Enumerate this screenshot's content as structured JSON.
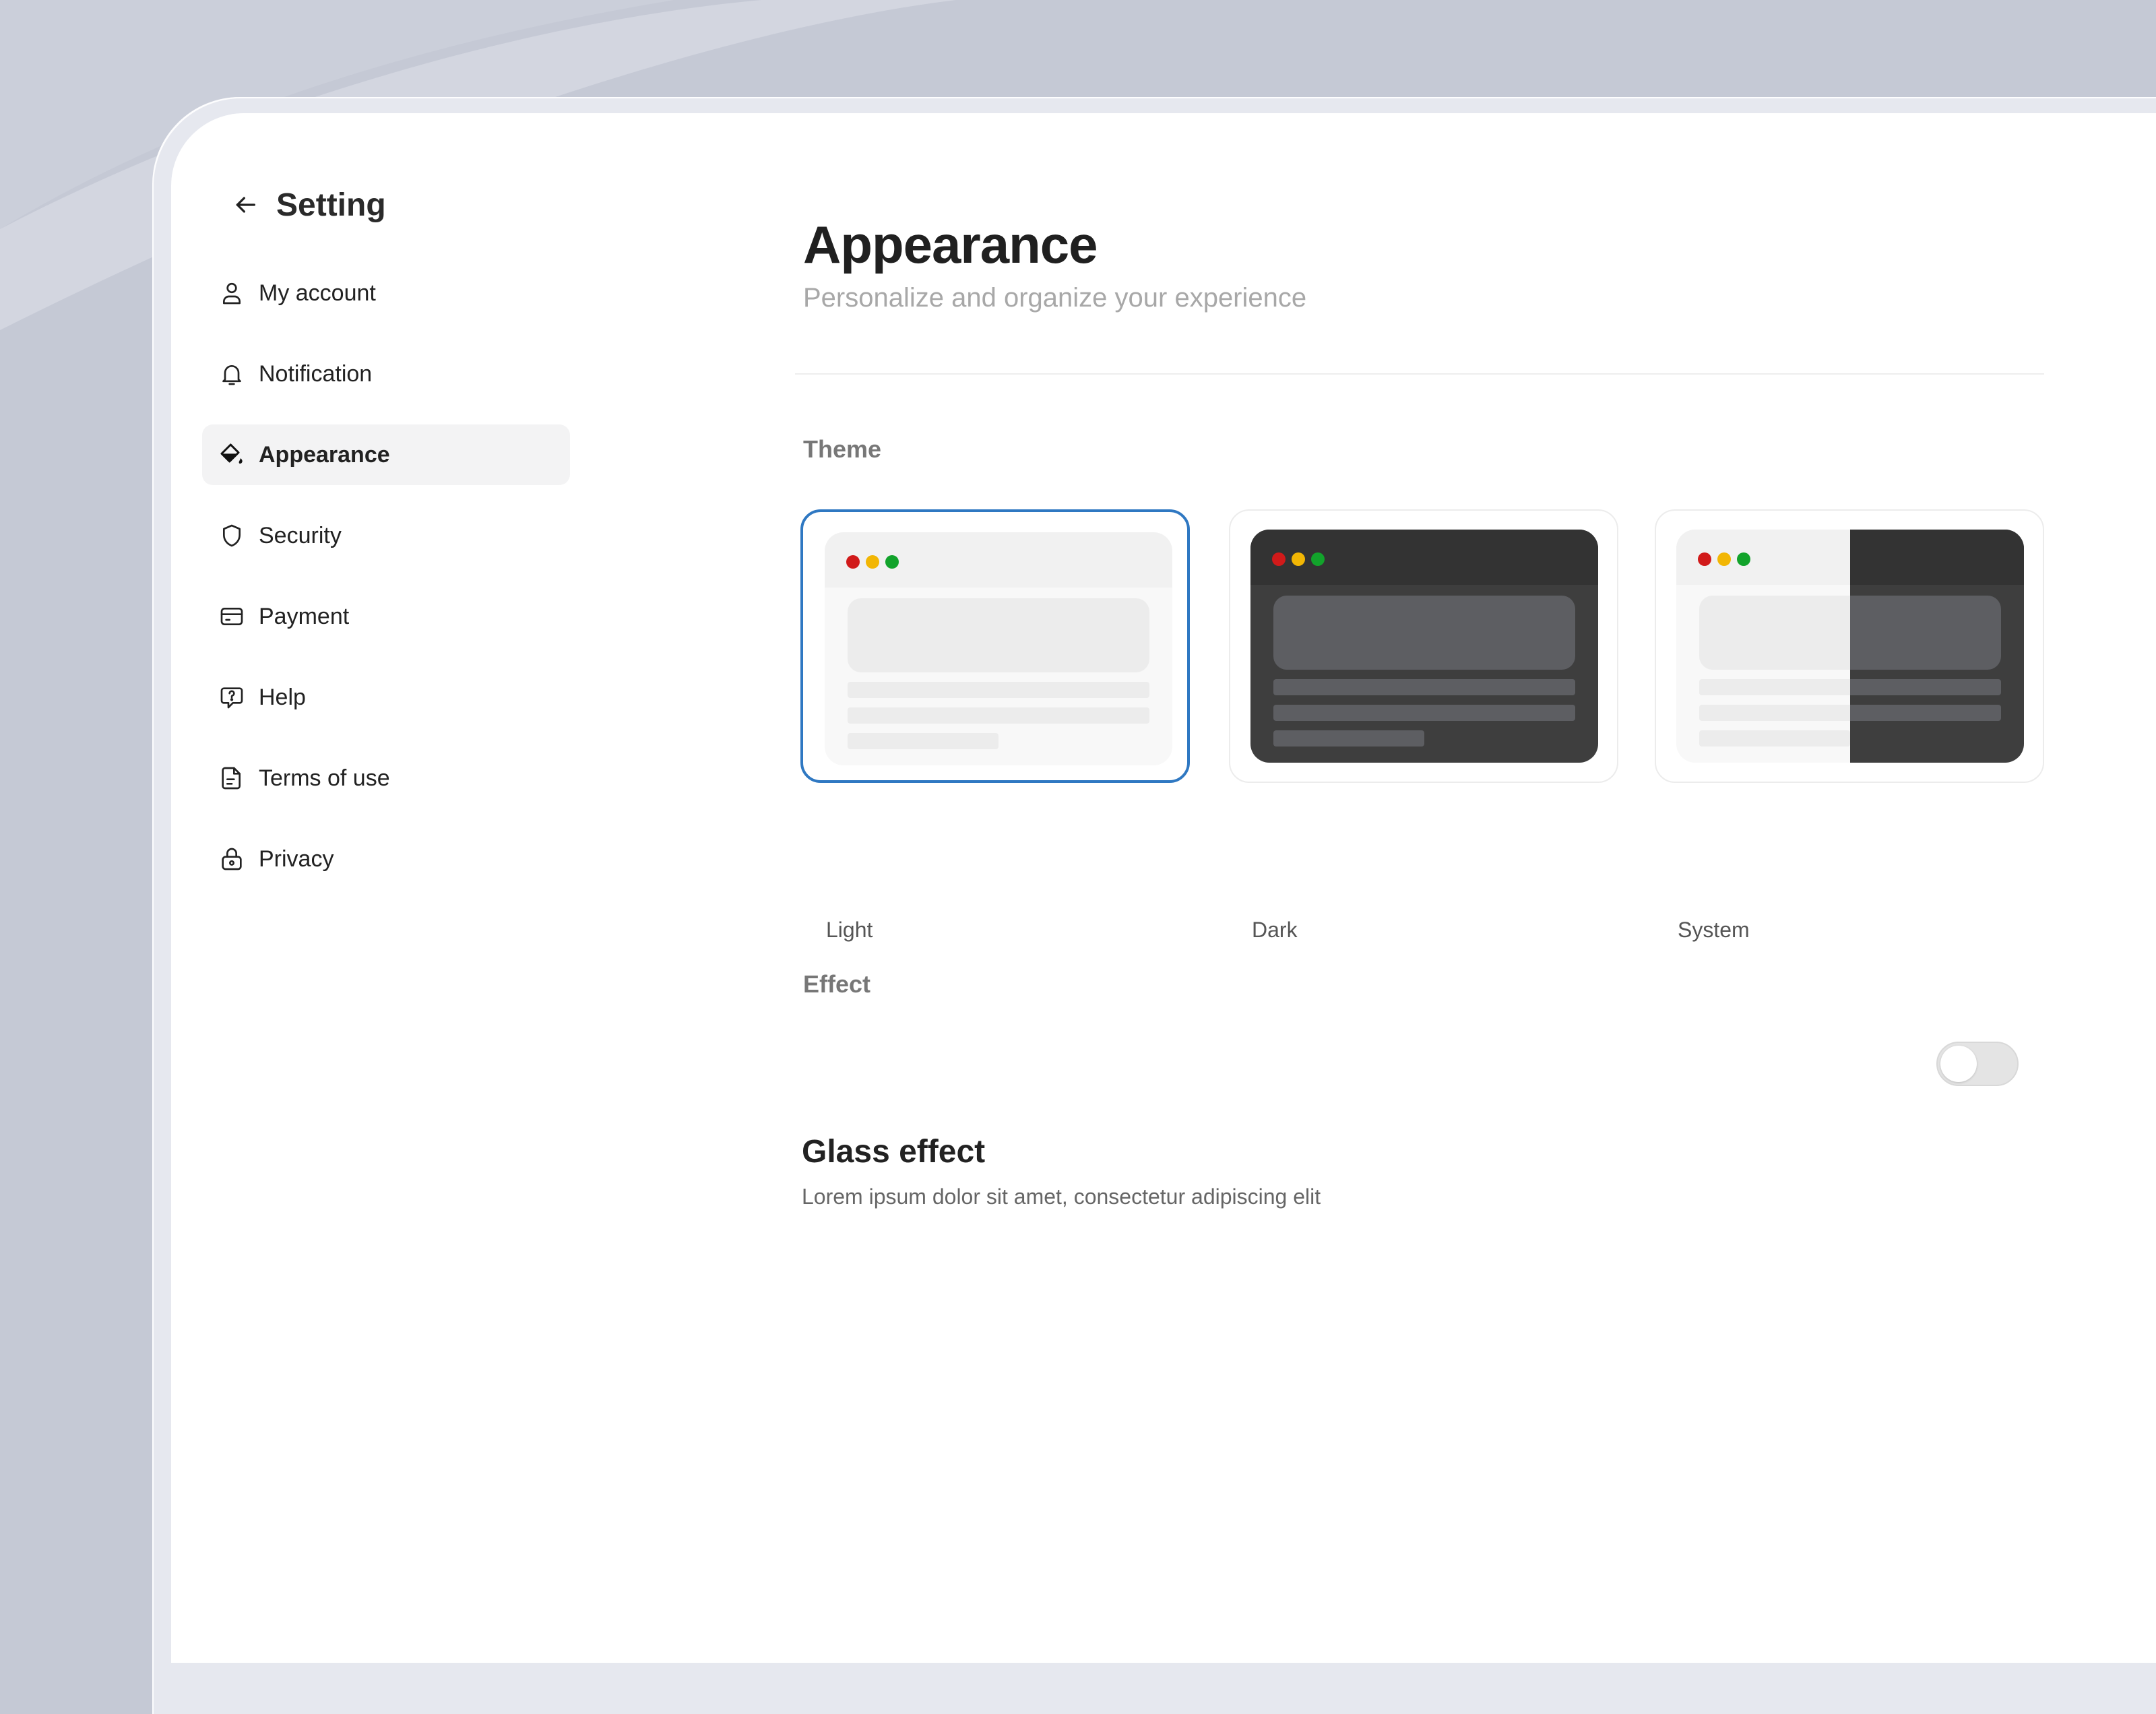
{
  "sidebar": {
    "title": "Setting",
    "items": [
      {
        "label": "My account",
        "icon": "user-icon"
      },
      {
        "label": "Notification",
        "icon": "bell-icon"
      },
      {
        "label": "Appearance",
        "icon": "paint-bucket-icon",
        "active": true
      },
      {
        "label": "Security",
        "icon": "shield-icon"
      },
      {
        "label": "Payment",
        "icon": "credit-card-icon"
      },
      {
        "label": "Help",
        "icon": "help-bubble-icon"
      },
      {
        "label": "Terms of use",
        "icon": "document-icon"
      },
      {
        "label": "Privacy",
        "icon": "lock-icon"
      }
    ]
  },
  "main": {
    "title": "Appearance",
    "subtitle": "Personalize and organize your experience",
    "theme_section": {
      "label": "Theme",
      "options": [
        {
          "label": "Light",
          "selected": true
        },
        {
          "label": "Dark",
          "selected": false
        },
        {
          "label": "System",
          "selected": false
        }
      ]
    },
    "effect_section": {
      "label": "Effect",
      "title": "Glass effect",
      "description": "Lorem ipsum dolor sit amet, consectetur adipiscing elit",
      "enabled": false
    }
  },
  "colors": {
    "background": "#c5c9d5",
    "accent": "#2f78c2",
    "dot_red": "#d11a1a",
    "dot_yellow": "#f2b604",
    "dot_green": "#12a32b"
  }
}
